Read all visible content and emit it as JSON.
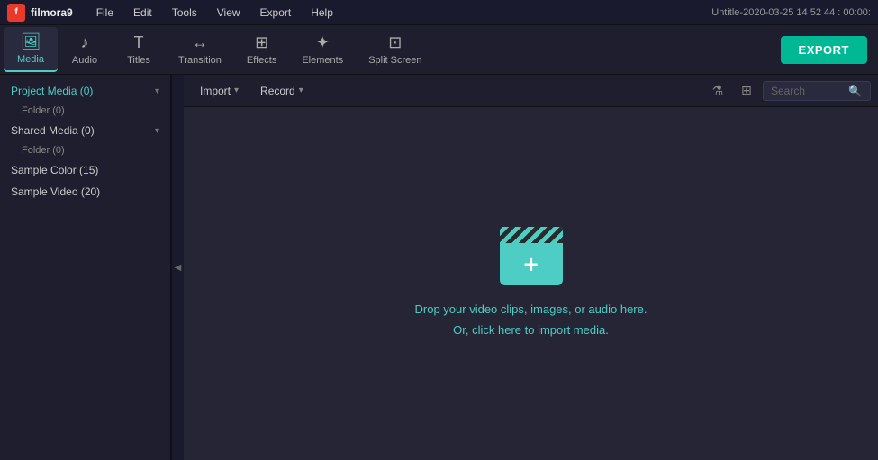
{
  "titlebar": {
    "logo": "f",
    "app_name": "filmora9",
    "menus": [
      "File",
      "Edit",
      "Tools",
      "View",
      "Export",
      "Help"
    ],
    "window_title": "Untitle-2020-03-25 14 52 44 : 00:00:"
  },
  "toolbar": {
    "items": [
      {
        "id": "media",
        "label": "Media",
        "icon": "🖼"
      },
      {
        "id": "audio",
        "label": "Audio",
        "icon": "♪"
      },
      {
        "id": "titles",
        "label": "Titles",
        "icon": "T"
      },
      {
        "id": "transition",
        "label": "Transition",
        "icon": "↔"
      },
      {
        "id": "effects",
        "label": "Effects",
        "icon": "⊞"
      },
      {
        "id": "elements",
        "label": "Elements",
        "icon": "✦"
      },
      {
        "id": "split_screen",
        "label": "Split Screen",
        "icon": "⊡"
      }
    ],
    "export_label": "EXPORT",
    "active_tab": "media"
  },
  "sidebar": {
    "items": [
      {
        "id": "project_media",
        "label": "Project Media (0)",
        "expandable": true,
        "active": true
      },
      {
        "id": "folder_0",
        "label": "Folder (0)",
        "indent": true
      },
      {
        "id": "shared_media",
        "label": "Shared Media (0)",
        "expandable": true
      },
      {
        "id": "folder_0b",
        "label": "Folder (0)",
        "indent": true
      },
      {
        "id": "sample_color",
        "label": "Sample Color (15)"
      },
      {
        "id": "sample_video",
        "label": "Sample Video (20)"
      }
    ],
    "collapse_icon": "◀"
  },
  "content_toolbar": {
    "import_label": "Import",
    "record_label": "Record",
    "filter_icon": "⚗",
    "grid_icon": "⊞",
    "search_placeholder": "Search"
  },
  "drop_area": {
    "line1": "Drop your video clips, images, or audio here.",
    "line2": "Or, click here to import media."
  }
}
